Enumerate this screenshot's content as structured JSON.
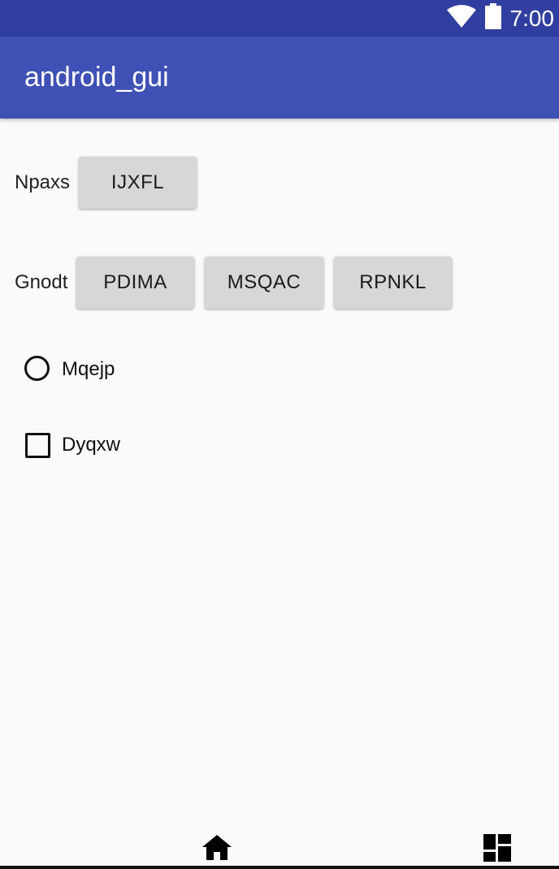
{
  "status_bar": {
    "time": "7:00",
    "icons": [
      "wifi-icon",
      "battery-icon"
    ]
  },
  "app_bar": {
    "title": "android_gui"
  },
  "rows": [
    {
      "label": "Npaxs",
      "buttons": [
        "IJXFL"
      ]
    },
    {
      "label": "Gnodt",
      "buttons": [
        "PDIMA",
        "MSQAC",
        "RPNKL"
      ]
    }
  ],
  "options": {
    "radio_label": "Mqejp",
    "radio_checked": false,
    "checkbox_label": "Dyqxw",
    "checkbox_checked": false
  },
  "nav_bar": {
    "icons": [
      "home-icon",
      "dashboard-icon"
    ]
  },
  "colors": {
    "status_bar": "#303f9f",
    "app_bar": "#3f51b5",
    "background": "#fafafa",
    "button": "#d6d7d7"
  }
}
